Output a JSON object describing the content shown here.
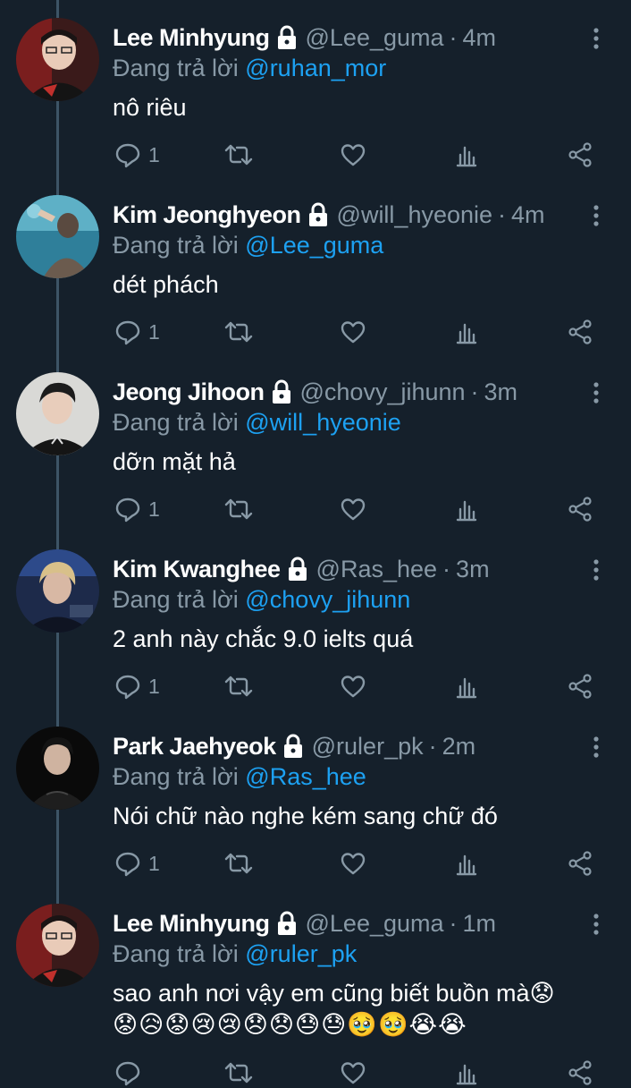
{
  "reply_prefix": "Đang trả lời",
  "tweets": [
    {
      "name": "Lee Minhyung",
      "handle": "@Lee_guma",
      "separator": "·",
      "time": "4m",
      "reply_to": "@ruhan_mor",
      "text": "nô riêu",
      "emoji_line": "",
      "reply_count": "1"
    },
    {
      "name": "Kim Jeonghyeon",
      "handle": "@will_hyeonie",
      "separator": "·",
      "time": "4m",
      "reply_to": "@Lee_guma",
      "text": "dét phách",
      "emoji_line": "",
      "reply_count": "1"
    },
    {
      "name": "Jeong Jihoon",
      "handle": "@chovy_jihunn",
      "separator": "·",
      "time": "3m",
      "reply_to": "@will_hyeonie",
      "text": "dỡn mặt hả",
      "emoji_line": "",
      "reply_count": "1"
    },
    {
      "name": "Kim Kwanghee",
      "handle": "@Ras_hee",
      "separator": "·",
      "time": "3m",
      "reply_to": "@chovy_jihunn",
      "text": "2 anh này chắc 9.0 ielts quá",
      "emoji_line": "",
      "reply_count": "1"
    },
    {
      "name": "Park Jaehyeok",
      "handle": "@ruler_pk",
      "separator": "·",
      "time": "2m",
      "reply_to": "@Ras_hee",
      "text": "Nói chữ nào nghe kém sang chữ đó",
      "emoji_line": "",
      "reply_count": "1"
    },
    {
      "name": "Lee Minhyung",
      "handle": "@Lee_guma",
      "separator": "·",
      "time": "1m",
      "reply_to": "@ruler_pk",
      "text": "sao anh nơi vậy em cũng biết buồn mà😟",
      "emoji_line": "😟😥😟😢😢😞😞😓😓🥹🥹😭😭",
      "reply_count": ""
    }
  ],
  "colors": {
    "background": "#15202b",
    "mention": "#1da1f2",
    "secondary_text": "#8899a6",
    "thread_line": "#3d5466"
  },
  "icons": {
    "lock": "lock-icon",
    "more": "more-vertical-icon",
    "reply": "reply-icon",
    "retweet": "retweet-icon",
    "like": "heart-icon",
    "views": "views-icon",
    "share": "share-icon"
  }
}
